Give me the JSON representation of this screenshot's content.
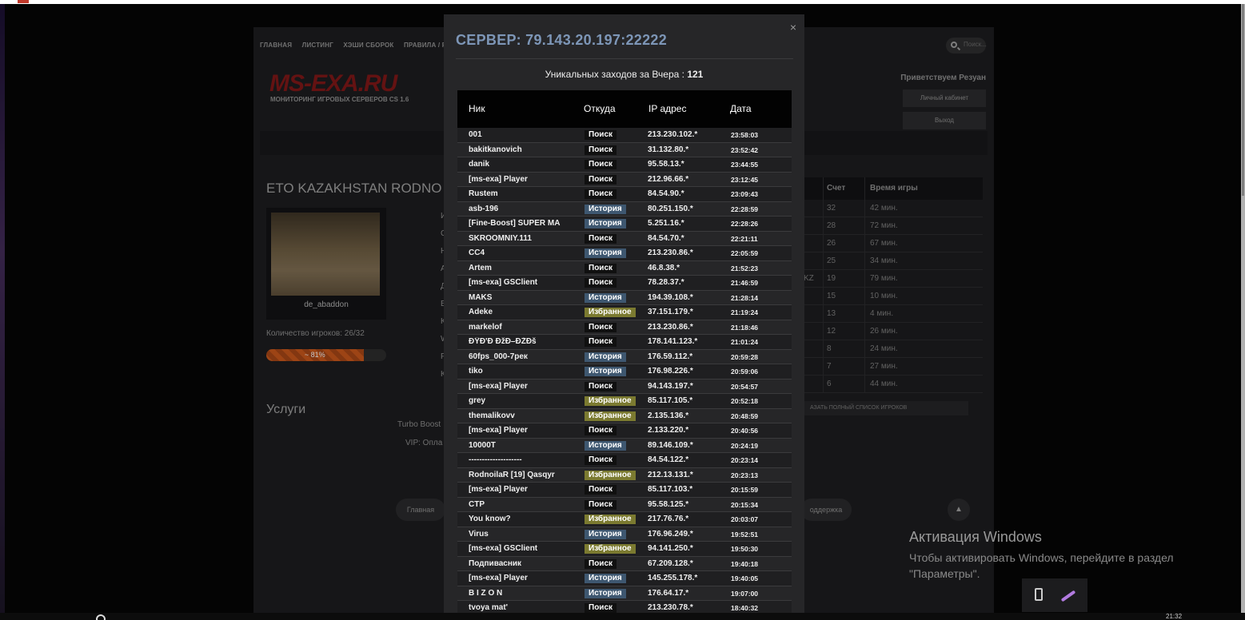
{
  "site": {
    "nav": [
      "ГЛАВНАЯ",
      "ЛИСТИНГ",
      "ХЭШИ СБОРОК",
      "ПРАВИЛА / FAQ"
    ],
    "search_placeholder": "Поиск...",
    "logo": "MS-EXA.RU",
    "logo_sub": "МОНИТОРИНГ ИГРОВЫХ СЕРВЕРОВ CS 1.6",
    "greeting": "Приветствуем Резуан",
    "cabinet": "Личный кабинет",
    "logout": "Выход",
    "server_title": "ETO KAZAKHSTAN RODNO",
    "map_name": "de_abaddon",
    "players_count": "Количество игроков:  26/32",
    "fill_pct": 81,
    "fill_text": "~ 81%",
    "services": "Услуги",
    "turbo": "Turbo Boost",
    "vip": "VIP:   Опла",
    "left_letters": [
      "И",
      "С",
      "Н",
      "А",
      "Д",
      "В",
      "К",
      "W",
      "Р",
      "К"
    ],
    "players_header": {
      "score": "Счет",
      "time": "Время игры"
    },
    "players": [
      {
        "tag": "",
        "score": "32",
        "time": "42 мин."
      },
      {
        "tag": "",
        "score": "28",
        "time": "72 мин."
      },
      {
        "tag": "",
        "score": "26",
        "time": "67 мин."
      },
      {
        "tag": "",
        "score": "25",
        "time": "34 мин."
      },
      {
        "tag": "KZ",
        "score": "19",
        "time": "79 мин."
      },
      {
        "tag": "",
        "score": "15",
        "time": "10 мин."
      },
      {
        "tag": "",
        "score": "13",
        "time": "4 мин."
      },
      {
        "tag": "",
        "score": "12",
        "time": "26 мин."
      },
      {
        "tag": "",
        "score": "8",
        "time": "24 мин."
      },
      {
        "tag": "",
        "score": "7",
        "time": "27 мин."
      },
      {
        "tag": "",
        "score": "6",
        "time": "44 мин."
      }
    ],
    "full_list": "АЗАТЬ ПОЛНЫЙ СПИСОК ИГРОКОВ",
    "footer_home": "Главная",
    "footer_support": "оддержка"
  },
  "modal": {
    "close": "×",
    "title": "СЕРВЕР: 79.143.20.197:22222",
    "stat_label": "Уникальных заходов за Вчера :",
    "stat_value": "121",
    "columns": {
      "nick": "Ник",
      "source": "Откуда",
      "ip": "IP адрес",
      "date": "Дата"
    },
    "rows": [
      {
        "nick": "001",
        "source": "Поиск",
        "type": "search",
        "ip": "213.230.102.*",
        "date": "23:58:03"
      },
      {
        "nick": "bakitkanovich",
        "source": "Поиск",
        "type": "search",
        "ip": "31.132.80.*",
        "date": "23:52:42"
      },
      {
        "nick": "danik",
        "source": "Поиск",
        "type": "search",
        "ip": "95.58.13.*",
        "date": "23:44:55"
      },
      {
        "nick": "[ms-exa] Player",
        "source": "Поиск",
        "type": "search",
        "ip": "212.96.66.*",
        "date": "23:12:45"
      },
      {
        "nick": "Rustem",
        "source": "Поиск",
        "type": "search",
        "ip": "84.54.90.*",
        "date": "23:09:43"
      },
      {
        "nick": "asb-196",
        "source": "История",
        "type": "hist",
        "ip": "80.251.150.*",
        "date": "22:28:59"
      },
      {
        "nick": "[Fine-Boost] SUPER MA",
        "source": "История",
        "type": "hist",
        "ip": "5.251.16.*",
        "date": "22:28:26"
      },
      {
        "nick": "SKROOMNIY.111",
        "source": "Поиск",
        "type": "search",
        "ip": "84.54.70.*",
        "date": "22:21:11"
      },
      {
        "nick": "CC4",
        "source": "История",
        "type": "hist",
        "ip": "213.230.86.*",
        "date": "22:05:59"
      },
      {
        "nick": "Artem",
        "source": "Поиск",
        "type": "search",
        "ip": "46.8.38.*",
        "date": "21:52:23"
      },
      {
        "nick": "[ms-exa] GSClient",
        "source": "Поиск",
        "type": "search",
        "ip": "78.28.37.*",
        "date": "21:46:59"
      },
      {
        "nick": "MAKS",
        "source": "История",
        "type": "hist",
        "ip": "194.39.108.*",
        "date": "21:28:14"
      },
      {
        "nick": "Adeke",
        "source": "Избранное",
        "type": "fav",
        "ip": "37.151.179.*",
        "date": "21:19:24"
      },
      {
        "nick": "markelof",
        "source": "Поиск",
        "type": "search",
        "ip": "213.230.86.*",
        "date": "21:18:46"
      },
      {
        "nick": "ÐŸÐ'Ð ÐžÐ–ÐŽÐš",
        "source": "Поиск",
        "type": "search",
        "ip": "178.141.123.*",
        "date": "21:01:24"
      },
      {
        "nick": "60fps_000-7рек",
        "source": "История",
        "type": "hist",
        "ip": "176.59.112.*",
        "date": "20:59:28"
      },
      {
        "nick": "tiko",
        "source": "История",
        "type": "hist",
        "ip": "176.98.226.*",
        "date": "20:59:06"
      },
      {
        "nick": "[ms-exa] Player",
        "source": "Поиск",
        "type": "search",
        "ip": "94.143.197.*",
        "date": "20:54:57"
      },
      {
        "nick": "grey",
        "source": "Избранное",
        "type": "fav",
        "ip": "85.117.105.*",
        "date": "20:52:18"
      },
      {
        "nick": "themalikovv",
        "source": "Избранное",
        "type": "fav",
        "ip": "2.135.136.*",
        "date": "20:48:59"
      },
      {
        "nick": "[ms-exa] Player",
        "source": "Поиск",
        "type": "search",
        "ip": "2.133.220.*",
        "date": "20:40:56"
      },
      {
        "nick": "10000T",
        "source": "История",
        "type": "hist",
        "ip": "89.146.109.*",
        "date": "20:24:19"
      },
      {
        "nick": "--------------------",
        "source": "Поиск",
        "type": "search",
        "ip": "84.54.122.*",
        "date": "20:23:14"
      },
      {
        "nick": "RodnoilaR [19] Qasqyr",
        "source": "Избранное",
        "type": "fav",
        "ip": "212.13.131.*",
        "date": "20:23:13"
      },
      {
        "nick": "[ms-exa] Player",
        "source": "Поиск",
        "type": "search",
        "ip": "85.117.103.*",
        "date": "20:15:59"
      },
      {
        "nick": "CTP",
        "source": "Поиск",
        "type": "search",
        "ip": "95.58.125.*",
        "date": "20:15:34"
      },
      {
        "nick": "You know?",
        "source": "Избранное",
        "type": "fav",
        "ip": "217.76.76.*",
        "date": "20:03:07"
      },
      {
        "nick": "Virus",
        "source": "История",
        "type": "hist",
        "ip": "176.96.249.*",
        "date": "19:52:51"
      },
      {
        "nick": "[ms-exa] GSClient",
        "source": "Избранное",
        "type": "fav",
        "ip": "94.141.250.*",
        "date": "19:50:30"
      },
      {
        "nick": "Подпивасник",
        "source": "Поиск",
        "type": "search",
        "ip": "67.209.128.*",
        "date": "19:40:18"
      },
      {
        "nick": "[ms-exa] Player",
        "source": "История",
        "type": "hist",
        "ip": "145.255.178.*",
        "date": "19:40:05"
      },
      {
        "nick": "B I Z O N",
        "source": "История",
        "type": "hist",
        "ip": "176.64.17.*",
        "date": "19:07:00"
      },
      {
        "nick": "tvoya mat'",
        "source": "Поиск",
        "type": "search",
        "ip": "213.230.78.*",
        "date": "18:40:32"
      }
    ]
  },
  "windows": {
    "title": "Активация Windows",
    "text": "Чтобы активировать Windows, перейдите в раздел \"Параметры\"."
  },
  "clock": "21:32"
}
